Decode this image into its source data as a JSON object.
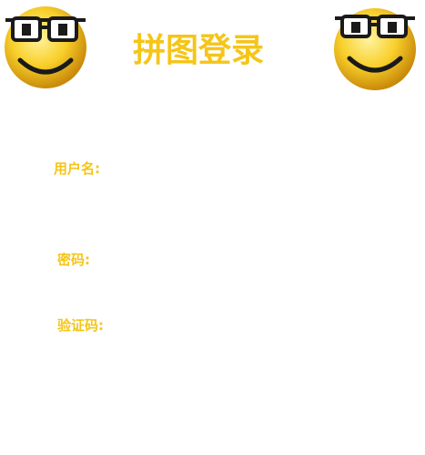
{
  "header": {
    "title": "拼图登录",
    "left_icon": "smiley-glasses-icon",
    "right_icon": "smiley-glasses-icon"
  },
  "form": {
    "username": {
      "label": "用户名:",
      "value": "",
      "placeholder": ""
    },
    "password": {
      "label": "密码:",
      "value": "",
      "placeholder": ""
    },
    "captcha": {
      "label": "验证码:",
      "value": "",
      "placeholder": ""
    }
  },
  "colors": {
    "accent": "#f5c518",
    "background": "#ffffff"
  }
}
